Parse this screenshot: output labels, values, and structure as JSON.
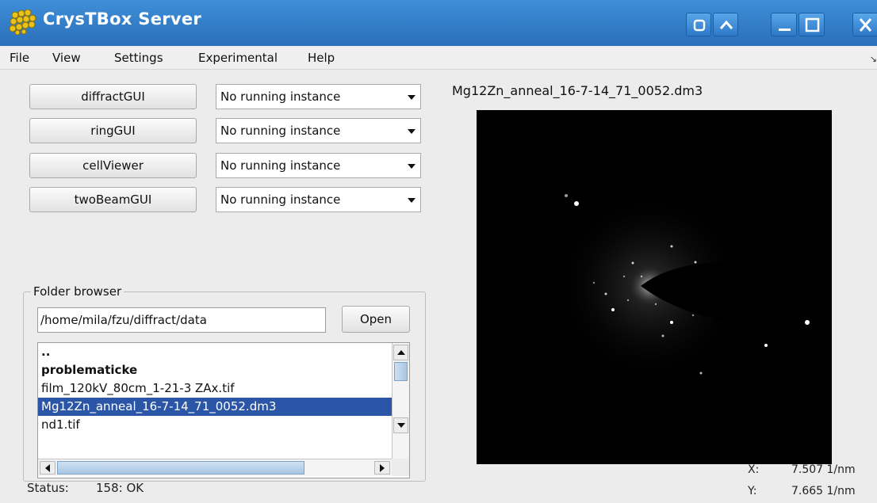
{
  "window": {
    "title": "CrysTBox Server",
    "icons": [
      "crystal-logo-icon",
      "restore-icon",
      "chevron-up-icon",
      "minimize-icon",
      "maximize-icon",
      "close-icon"
    ]
  },
  "menu": {
    "file": "File",
    "view": "View",
    "settings": "Settings",
    "experimental": "Experimental",
    "help": "Help"
  },
  "tools": [
    {
      "label": "diffractGUI",
      "instance": "No running instance"
    },
    {
      "label": "ringGUI",
      "instance": "No running instance"
    },
    {
      "label": "cellViewer",
      "instance": "No running instance"
    },
    {
      "label": "twoBeamGUI",
      "instance": "No running instance"
    }
  ],
  "folder_browser": {
    "legend": "Folder browser",
    "path": "/home/mila/fzu/diffract/data",
    "open_label": "Open",
    "items": [
      {
        "name": "..",
        "type": "parent"
      },
      {
        "name": "problematicke",
        "type": "folder"
      },
      {
        "name": "film_120kV_80cm_1-21-3 ZAx.tif",
        "type": "file"
      },
      {
        "name": "Mg12Zn_anneal_16-7-14_71_0052.dm3",
        "type": "file",
        "selected": true
      },
      {
        "name": "nd1.tif",
        "type": "file"
      }
    ]
  },
  "status": {
    "label": "Status:",
    "value": "158: OK"
  },
  "image": {
    "title": "Mg12Zn_anneal_16-7-14_71_0052.dm3",
    "x_label": "X:",
    "x_value": "7.507 1/nm",
    "y_label": "Y:",
    "y_value": "7.665 1/nm"
  },
  "colors": {
    "titlebar": "#2f7ac6",
    "selection": "#2b56a8",
    "background": "#ececec"
  }
}
